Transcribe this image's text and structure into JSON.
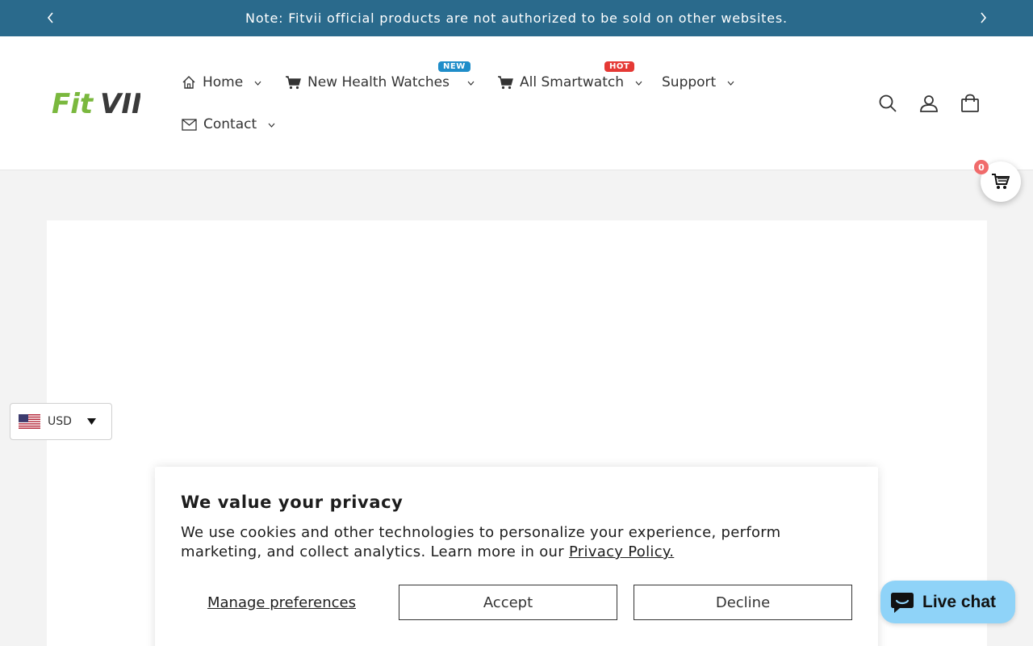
{
  "announcement": {
    "text": "Note: Fitvii official products are not authorized to be sold on other websites."
  },
  "logo": {
    "text": "FitVII"
  },
  "nav": {
    "items": [
      {
        "label": "Home",
        "icon": "home-icon"
      },
      {
        "label": "New Health Watches",
        "icon": "cart-icon",
        "badge": "NEW"
      },
      {
        "label": "All Smartwatch",
        "icon": "cart-icon",
        "badge": "HOT"
      },
      {
        "label": "Support"
      },
      {
        "label": "Contact",
        "icon": "mail-icon"
      }
    ]
  },
  "header_icons": [
    "search-icon",
    "account-icon",
    "bag-icon"
  ],
  "floating_cart": {
    "count": "0"
  },
  "currency": {
    "code": "USD",
    "flag": "us-flag-icon"
  },
  "privacy": {
    "title": "We value your privacy",
    "body": "We use cookies and other technologies to personalize your experience, perform marketing, and collect analytics. Learn more in our ",
    "policy_link": "Privacy Policy.",
    "manage_label": "Manage preferences",
    "accept_label": "Accept",
    "decline_label": "Decline"
  },
  "live_chat": {
    "label": "Live chat"
  },
  "colors": {
    "announcement_bg": "#2a6a8c",
    "badge_new": "#1f8dc9",
    "badge_hot": "#e53935",
    "cart_count_bg": "#f06b6b",
    "live_chat_bg": "#8fd3f8",
    "logo_green": "#7ab83e",
    "logo_dark": "#3a3a3a"
  }
}
